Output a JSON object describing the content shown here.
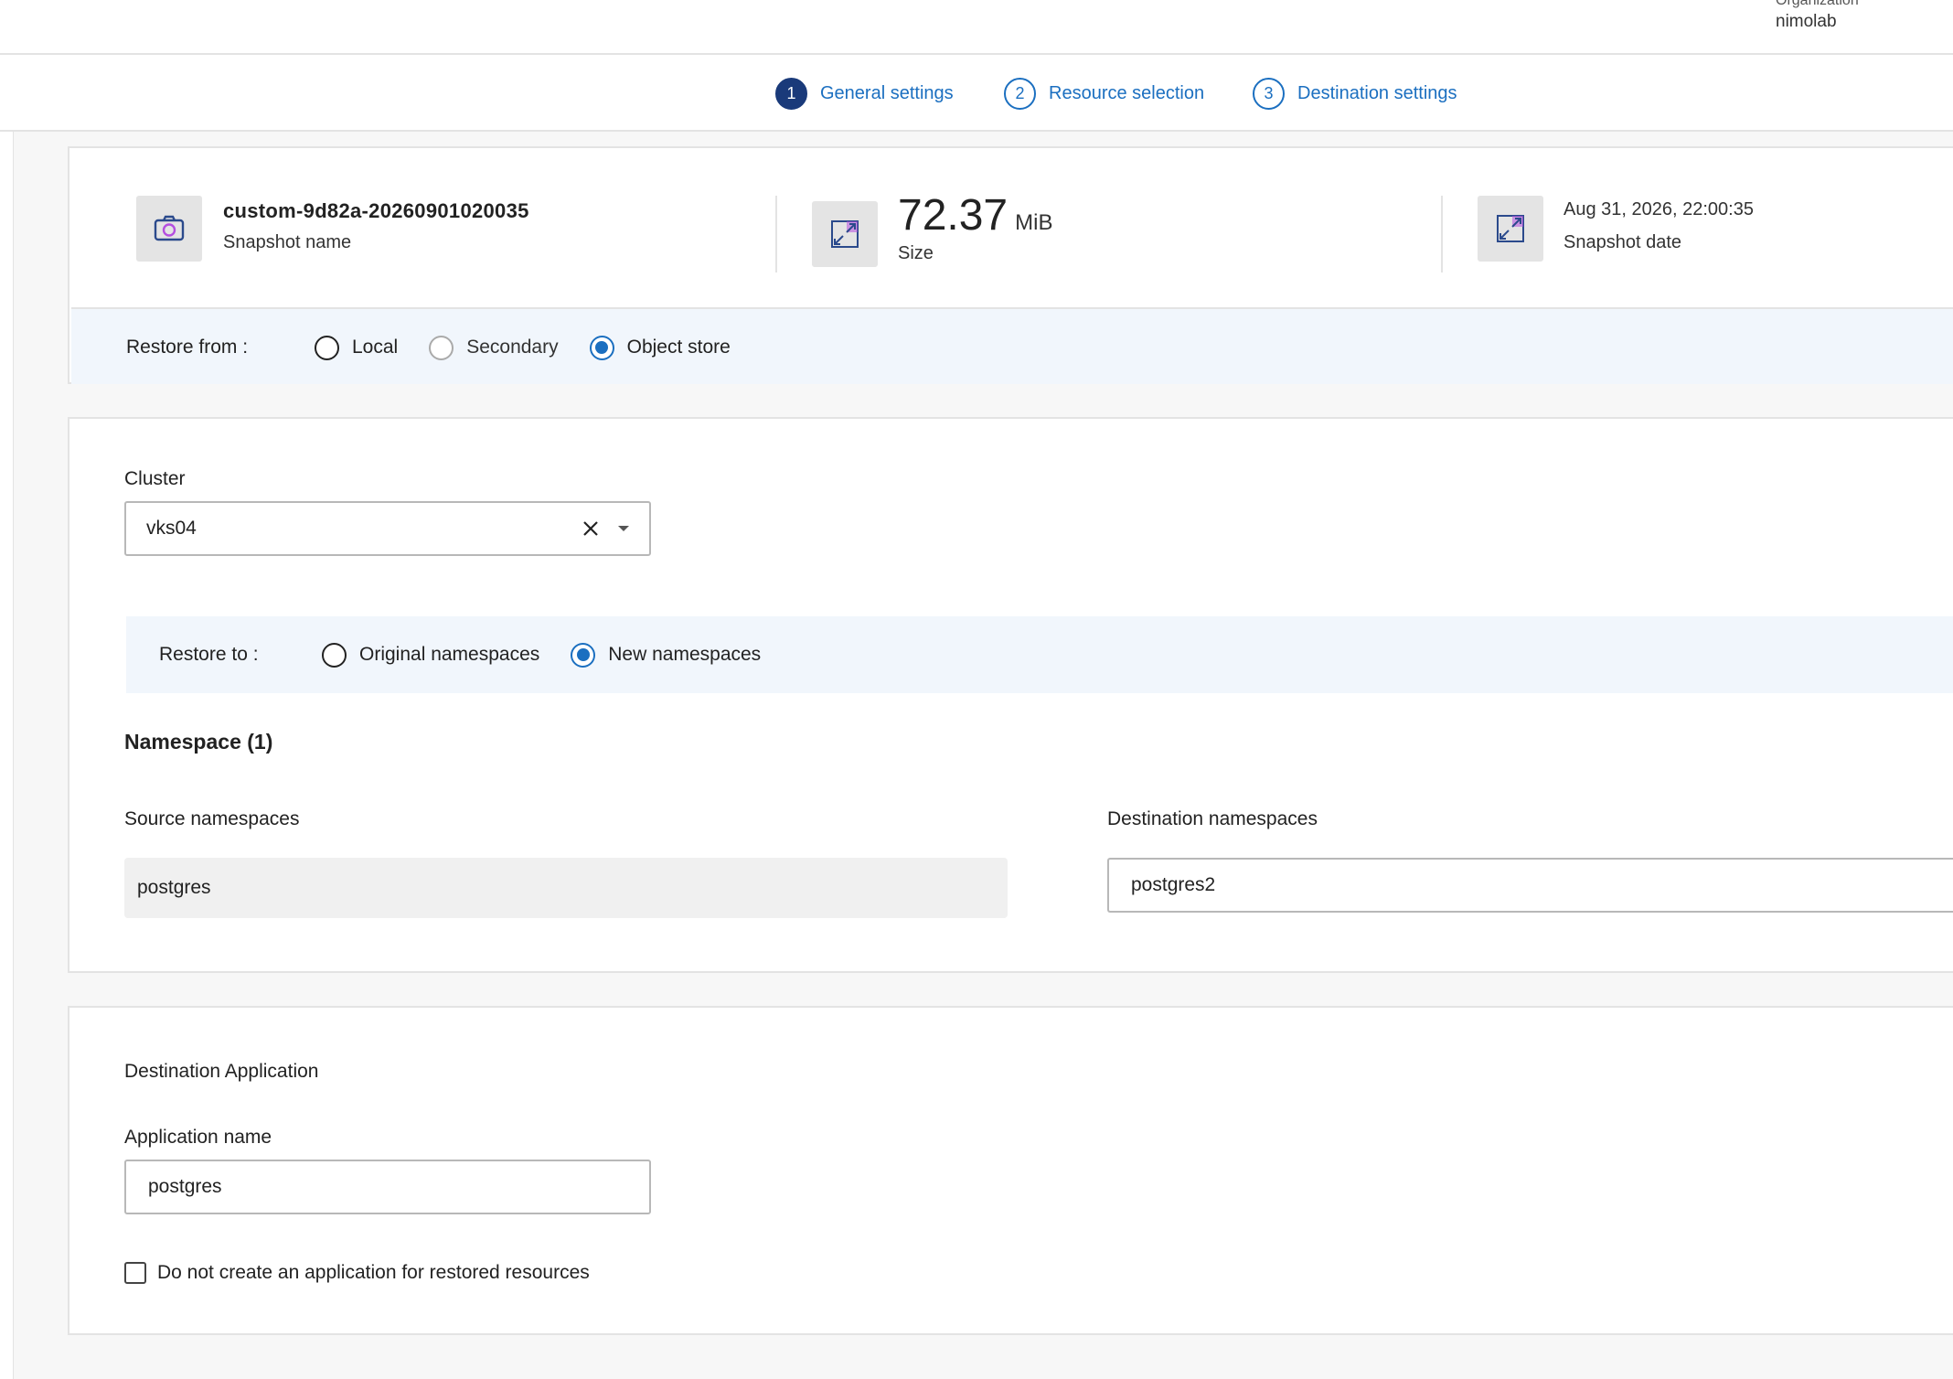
{
  "header": {
    "org_label": "Organization",
    "org_name": "nimolab"
  },
  "stepper": {
    "steps": [
      {
        "number": "1",
        "label": "General settings",
        "active": true
      },
      {
        "number": "2",
        "label": "Resource selection",
        "active": false
      },
      {
        "number": "3",
        "label": "Destination settings",
        "active": false
      }
    ]
  },
  "snapshot": {
    "name_value": "custom-9d82a-20260901020035",
    "name_label": "Snapshot name",
    "size_value": "72.37",
    "size_unit": "MiB",
    "size_label": "Size",
    "date_value": "Aug 31, 2026, 22:00:35",
    "date_label": "Snapshot date",
    "icons": {
      "name": "camera-icon",
      "size": "expand-icon",
      "date": "expand-icon"
    }
  },
  "restore_from": {
    "label": "Restore from :",
    "options": [
      {
        "label": "Local",
        "selected": false,
        "disabled": false
      },
      {
        "label": "Secondary",
        "selected": false,
        "disabled": true
      },
      {
        "label": "Object store",
        "selected": true,
        "disabled": false
      }
    ]
  },
  "destination": {
    "cluster_label": "Cluster",
    "cluster_value": "vks04",
    "restore_to_label": "Restore to :",
    "restore_to_options": [
      {
        "label": "Original namespaces",
        "selected": false
      },
      {
        "label": "New namespaces",
        "selected": true
      }
    ],
    "namespace_title": "Namespace (1)",
    "source_label": "Source namespaces",
    "source_value": "postgres",
    "dest_label": "Destination namespaces",
    "dest_value": "postgres2"
  },
  "application": {
    "title": "Destination Application",
    "name_label": "Application name",
    "name_value": "postgres",
    "checkbox_label": "Do not create an application for restored resources",
    "checkbox_checked": false
  },
  "colors": {
    "accent": "#1b6fc0",
    "active_step": "#1a3a7a",
    "strip_bg": "#f1f6fc",
    "icon_purple": "#b44fe0"
  }
}
